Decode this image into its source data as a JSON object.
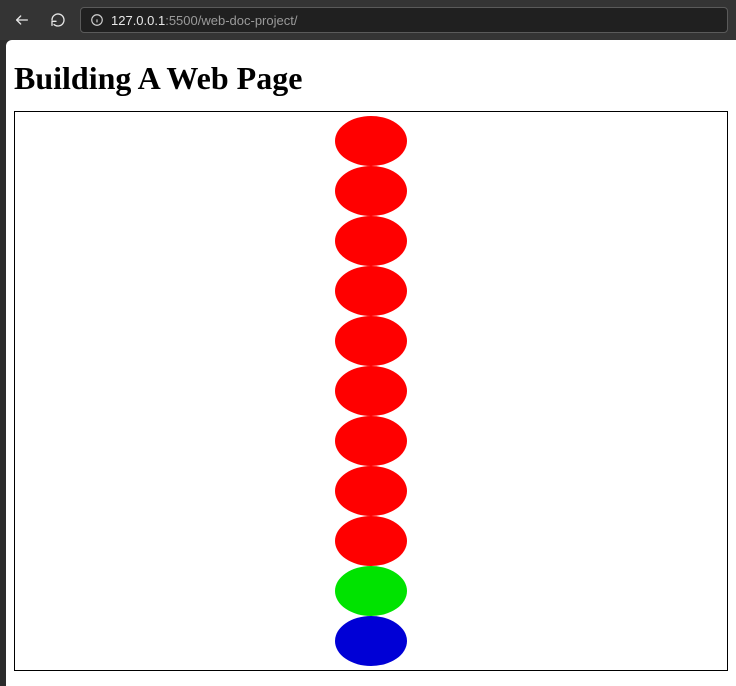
{
  "browser": {
    "url_host": "127.0.0.1",
    "url_port_path": ":5500/web-doc-project/"
  },
  "page": {
    "title": "Building A Web Page"
  },
  "colors": {
    "red": "#ff0000",
    "green": "#00e300",
    "blue": "#0000d6"
  },
  "ovals": [
    {
      "color_key": "red"
    },
    {
      "color_key": "red"
    },
    {
      "color_key": "red"
    },
    {
      "color_key": "red"
    },
    {
      "color_key": "red"
    },
    {
      "color_key": "red"
    },
    {
      "color_key": "red"
    },
    {
      "color_key": "red"
    },
    {
      "color_key": "red"
    },
    {
      "color_key": "green"
    },
    {
      "color_key": "blue"
    }
  ]
}
